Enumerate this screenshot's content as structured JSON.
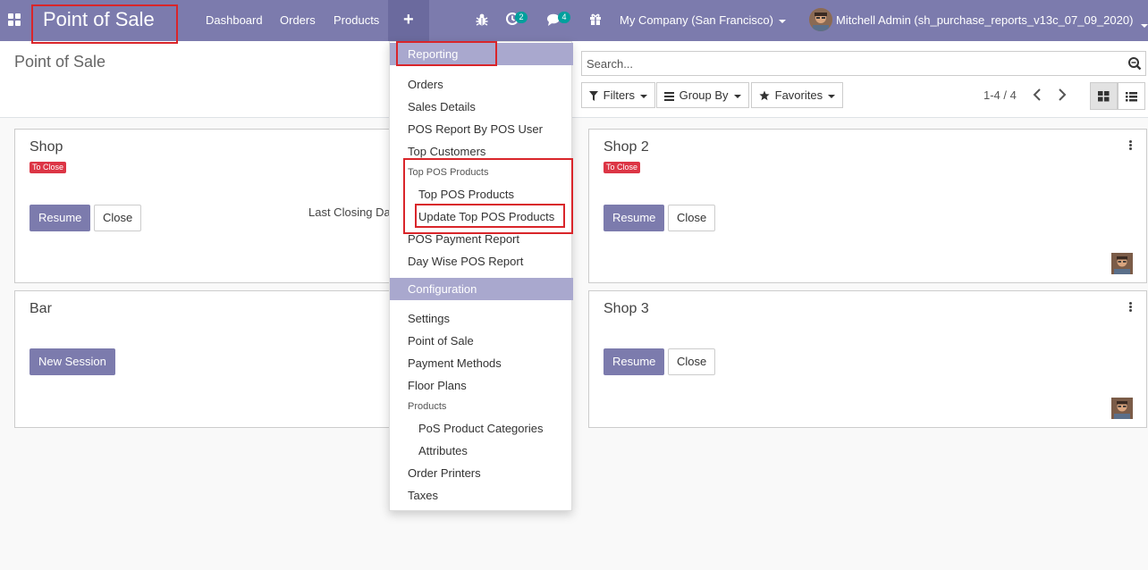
{
  "navbar": {
    "brand": "Point of Sale",
    "links": [
      "Dashboard",
      "Orders",
      "Products"
    ],
    "plus_label": "+",
    "activity_count": "2",
    "messages_count": "4",
    "company": "My Company (San Francisco)",
    "user": "Mitchell Admin (sh_purchase_reports_v13c_07_09_2020)"
  },
  "control_panel": {
    "title": "Point of Sale",
    "search_placeholder": "Search...",
    "filters_label": "Filters",
    "group_by_label": "Group By",
    "favorites_label": "Favorites",
    "pager": "1-4 / 4"
  },
  "cards": [
    {
      "title": "Shop",
      "tag": "To Close",
      "primary": "Resume",
      "secondary": "Close",
      "info": "Last Closing Da"
    },
    {
      "title": "Shop 2",
      "tag": "To Close",
      "primary": "Resume",
      "secondary": "Close"
    },
    {
      "title": "Bar",
      "primary": "New Session"
    },
    {
      "title": "Shop 3",
      "primary": "Resume",
      "secondary": "Close"
    }
  ],
  "menu": {
    "reporting_header": "Reporting",
    "reporting_items": [
      "Orders",
      "Sales Details",
      "POS Report By POS User",
      "Top Customers"
    ],
    "top_section": "Top POS Products",
    "top_sub": [
      "Top POS Products",
      "Update Top POS Products"
    ],
    "reporting_items_2": [
      "POS Payment Report",
      "Day Wise POS Report"
    ],
    "config_header": "Configuration",
    "config_items": [
      "Settings",
      "Point of Sale",
      "Payment Methods",
      "Floor Plans"
    ],
    "products_section": "Products",
    "products_sub": [
      "PoS Product Categories",
      "Attributes"
    ],
    "config_items_2": [
      "Order Printers",
      "Taxes"
    ]
  },
  "colors": {
    "navbar": "#7c7bad",
    "primary_button": "#7c7bad",
    "menu_header": "#a9a8ce",
    "badge": "#00a09d",
    "tag": "#dc3545",
    "highlight_box": "#d9252a"
  }
}
